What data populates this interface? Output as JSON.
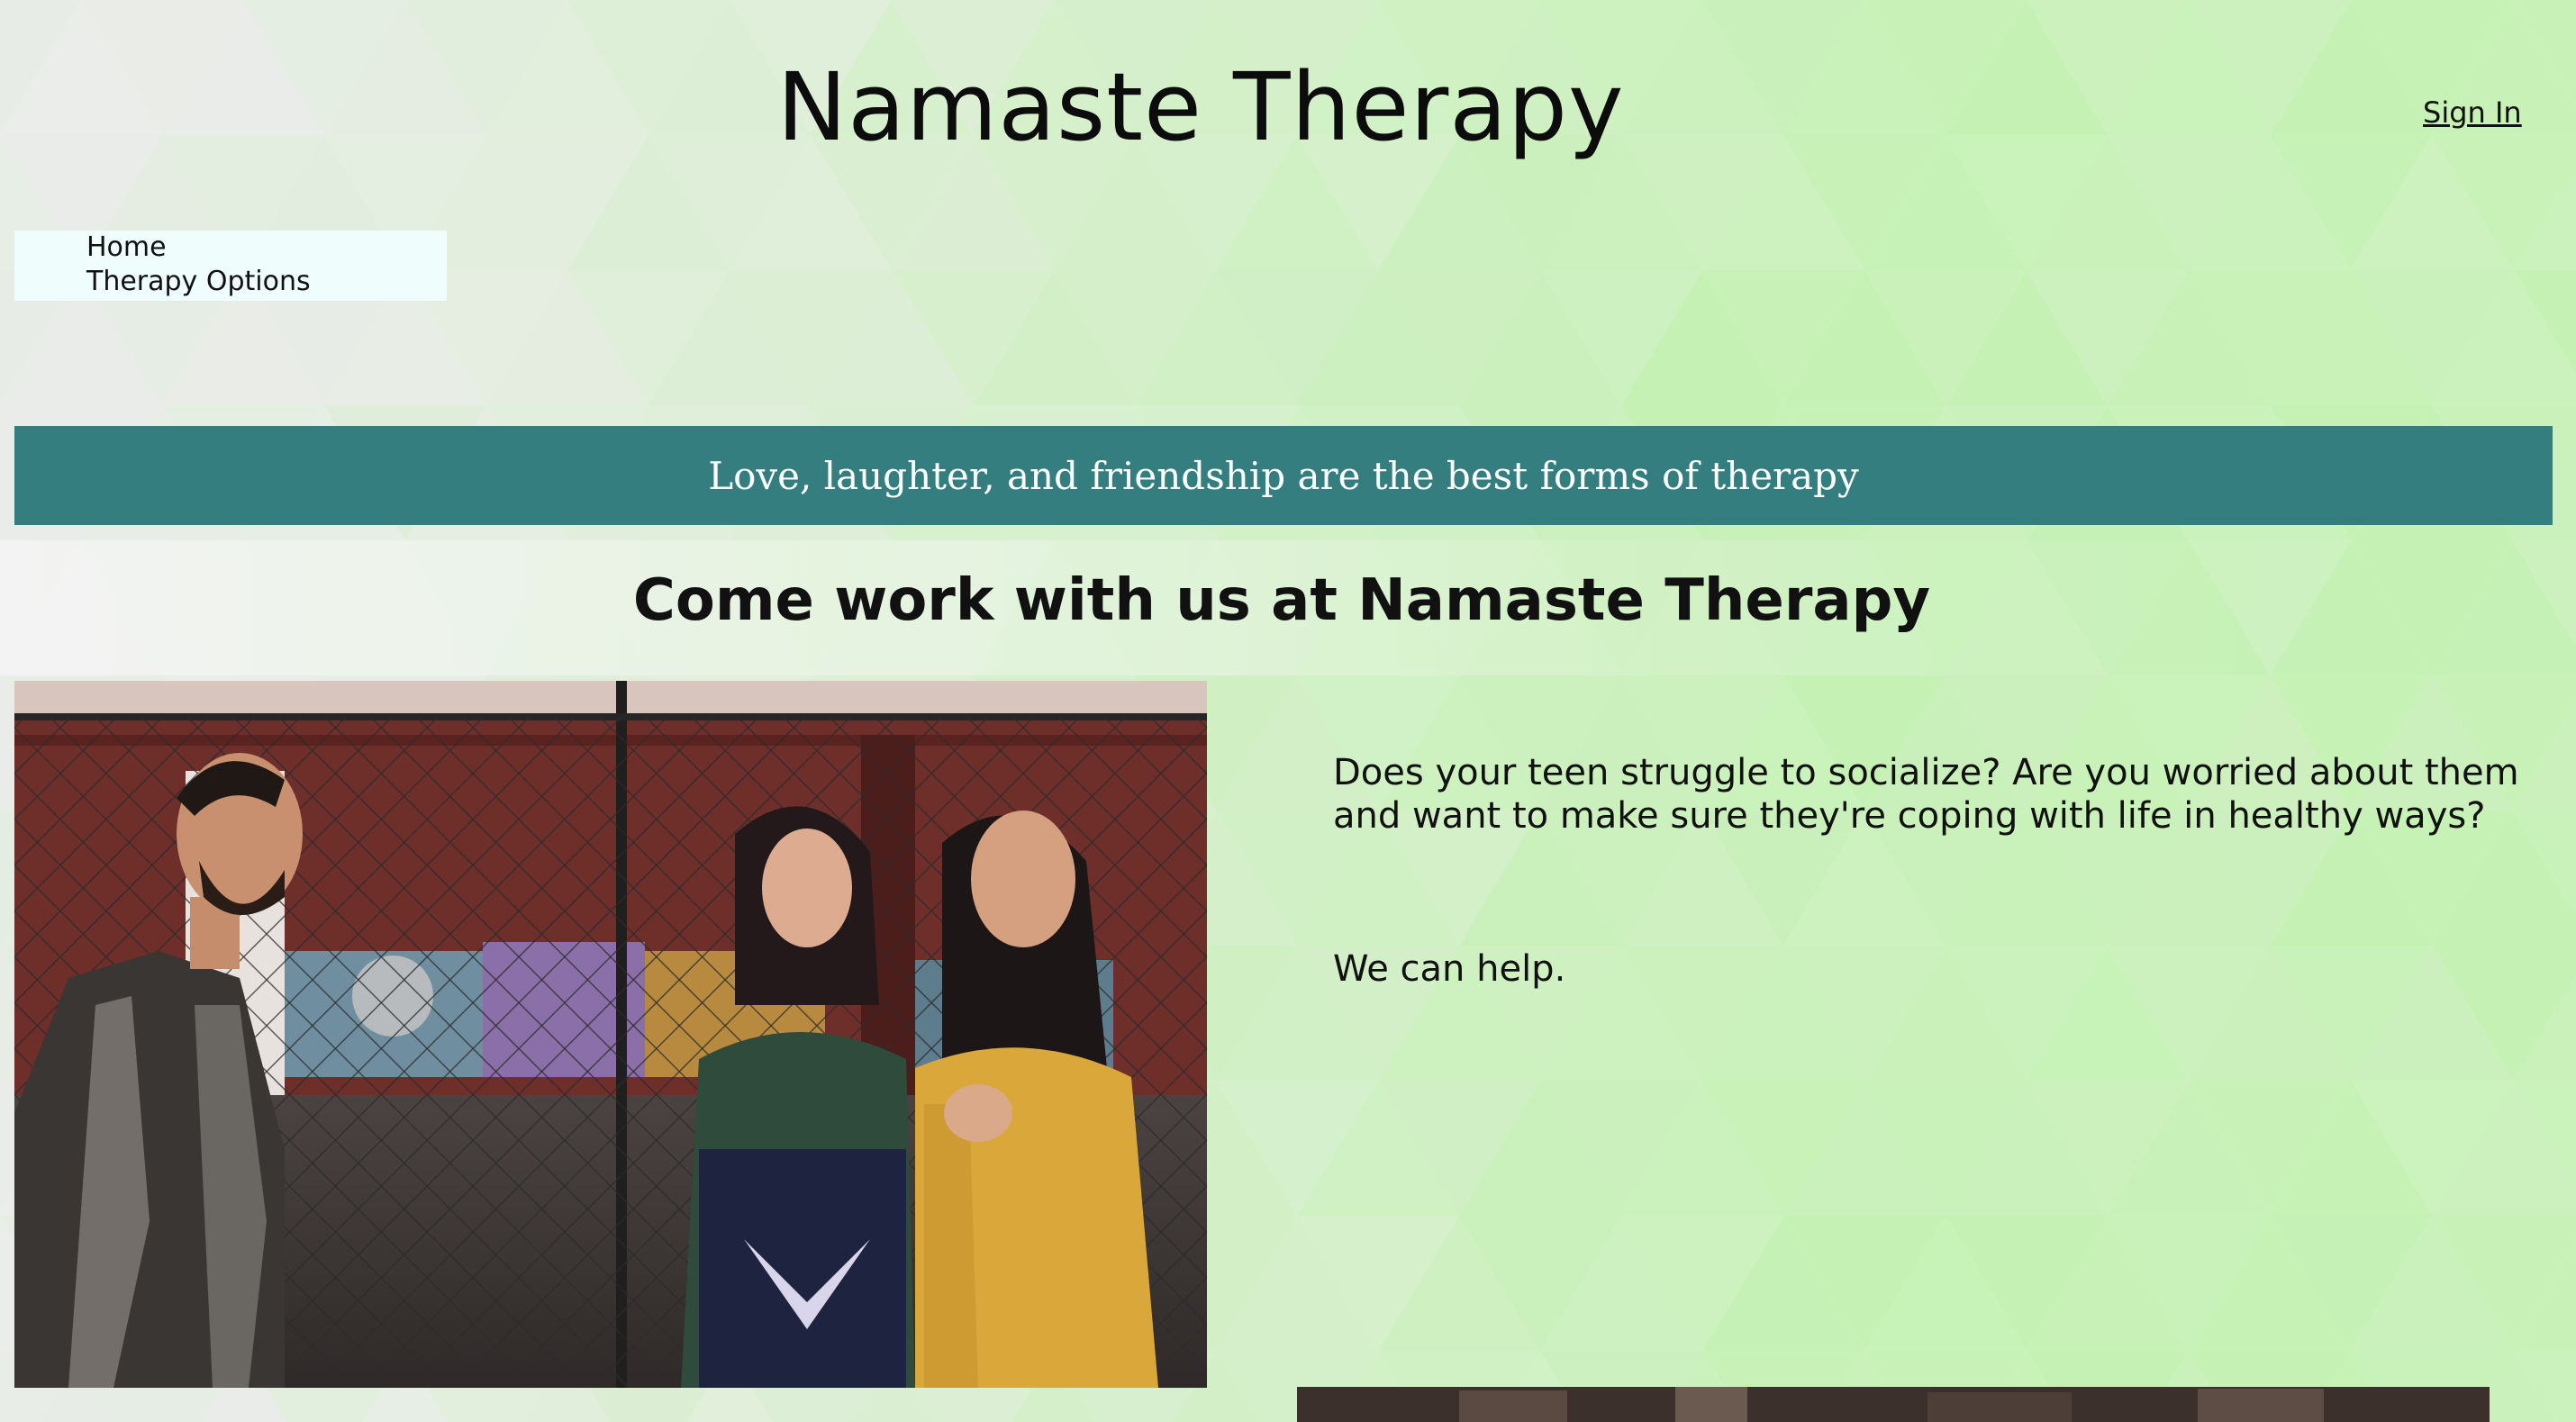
{
  "site": {
    "title": "Namaste Therapy",
    "sign_in": "Sign In"
  },
  "nav": {
    "items": [
      {
        "label": "Home"
      },
      {
        "label": "Therapy Options"
      }
    ]
  },
  "banner": {
    "text": "Love, laughter, and friendship are the best forms of therapy",
    "color": "#357e80"
  },
  "main": {
    "heading": "Come work with us at Namaste Therapy",
    "paragraph1": "Does your teen struggle to socialize? Are you worried about them and want to make sure they're coping with life in healthy ways?",
    "paragraph2": "We can help."
  },
  "colors": {
    "background_light": "#ecf9e8",
    "background_green": "#c5f1b4",
    "banner": "#357e80",
    "nav_bg": "#f0ffff"
  }
}
